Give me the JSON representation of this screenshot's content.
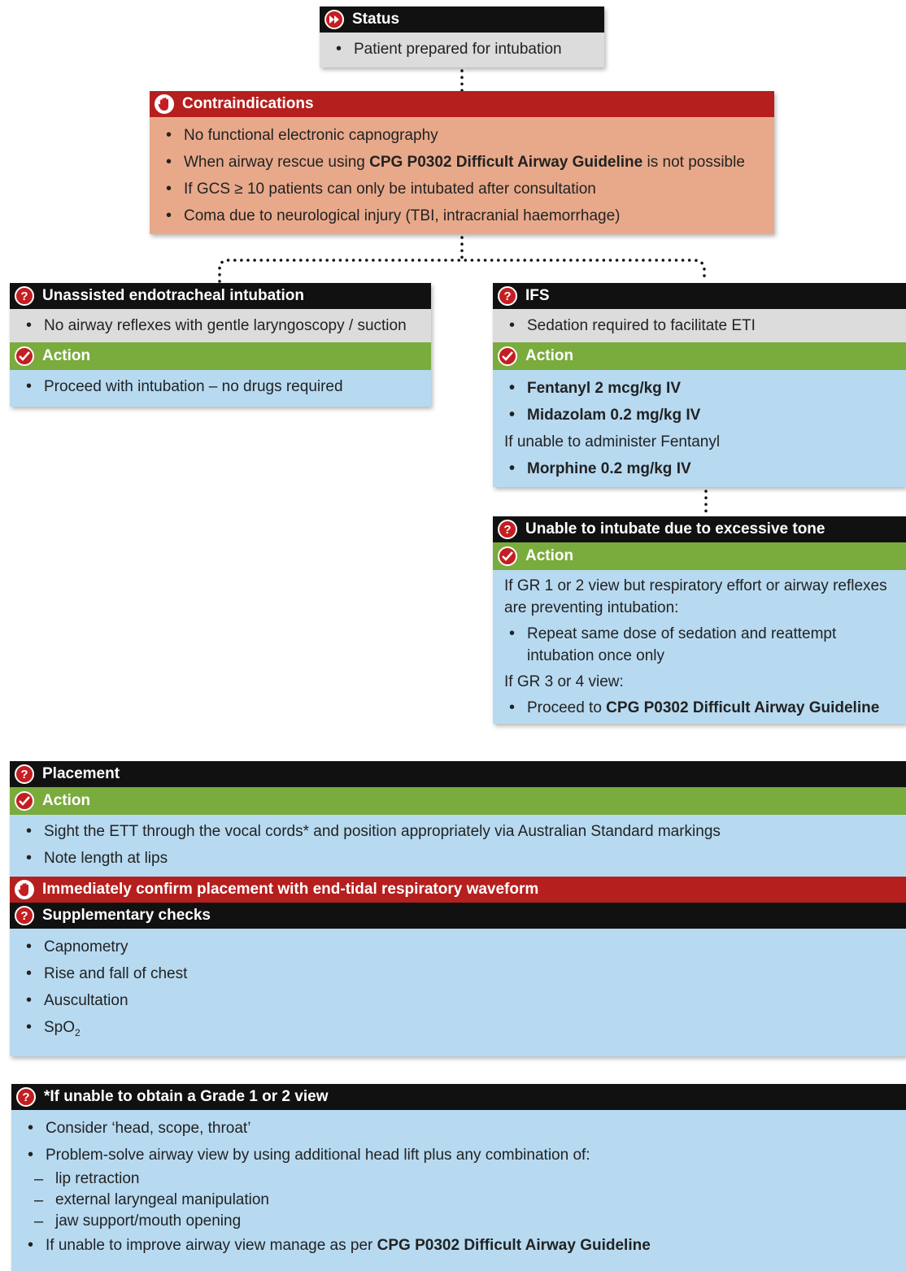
{
  "status": {
    "title": "Status",
    "items": [
      "Patient prepared for intubation"
    ]
  },
  "contraindications": {
    "title": "Contraindications",
    "items": [
      {
        "pre": "No functional electronic capnography",
        "bold": "",
        "post": ""
      },
      {
        "pre": "When airway rescue using ",
        "bold": "CPG P0302 Difficult Airway Guideline",
        "post": " is not possible"
      },
      {
        "pre": "If GCS ≥ 10 patients can only be intubated after consultation",
        "bold": "",
        "post": ""
      },
      {
        "pre": "Coma due to neurological injury (TBI, intracranial haemorrhage)",
        "bold": "",
        "post": ""
      }
    ]
  },
  "unassisted": {
    "title": "Unassisted endotracheal intubation",
    "condition": "No airway reflexes with gentle laryngoscopy / suction",
    "action_label": "Action",
    "action": "Proceed with intubation – no drugs required"
  },
  "ifs": {
    "title": "IFS",
    "condition": "Sedation required to facilitate ETI",
    "action_label": "Action",
    "drug1": "Fentanyl 2 mcg/kg IV",
    "drug2": "Midazolam 0.2 mg/kg IV",
    "alt_text": "If unable to administer Fentanyl",
    "drug3": "Morphine 0.2 mg/kg IV"
  },
  "tone": {
    "title": "Unable to intubate due to excessive tone",
    "action_label": "Action",
    "line1": "If GR 1 or 2 view but respiratory effort or airway reflexes",
    "line2": "are preventing intubation:",
    "bullet1a": "Repeat same dose of sedation and reattempt",
    "bullet1b": "intubation once only",
    "line3": "If GR 3 or 4 view:",
    "bullet2_pre": "Proceed to ",
    "bullet2_bold": "CPG P0302 Difficult Airway Guideline"
  },
  "placement": {
    "title": "Placement",
    "action_label": "Action",
    "items": [
      "Sight the ETT through the vocal cords* and position appropriately via Australian Standard markings",
      "Note length at lips"
    ],
    "confirm": "Immediately confirm placement with end-tidal respiratory waveform",
    "supp_title": "Supplementary checks",
    "supp_items": [
      "Capnometry",
      "Rise and fall of chest",
      "Auscultation"
    ],
    "spo2_main": "SpO",
    "spo2_sub": "2"
  },
  "grade": {
    "title": "*If unable to obtain a Grade 1 or 2 view",
    "item1": "Consider ‘head, scope, throat’",
    "item2": "Problem-solve airway view by using additional head lift plus any combination of:",
    "subitems": [
      "lip retraction",
      "external laryngeal manipulation",
      "jaw support/mouth opening"
    ],
    "item3_pre": "If unable to improve airway view manage as per ",
    "item3_bold": "CPG P0302 Difficult Airway Guideline"
  },
  "icons": {
    "status": "fast-forward-icon",
    "stop": "hand-stop-icon",
    "question": "question-icon",
    "check": "check-icon"
  },
  "colors": {
    "header_black": "#111111",
    "header_red": "#b51f1e",
    "action_green": "#7aab3d",
    "body_grey": "#dcdcdc",
    "body_salmon": "#e8a98b",
    "body_blue": "#b7daf1"
  }
}
